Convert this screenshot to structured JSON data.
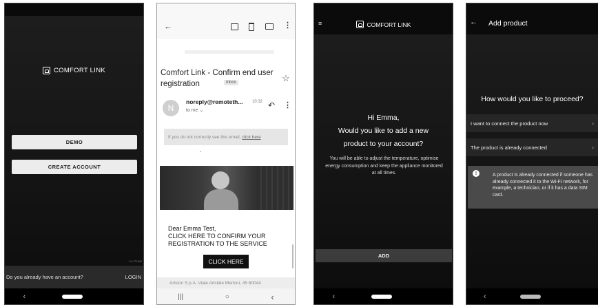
{
  "screen1": {
    "brand": "COMFORT LINK",
    "demo_label": "DEMO",
    "create_label": "CREATE ACCOUNT",
    "version": "5.0.772.800",
    "prompt": "Do you already have an account?",
    "login_label": "LOGIN"
  },
  "screen2": {
    "subject": "Comfort Link - Confirm end user registration",
    "badge": "Inbox",
    "avatar_initial": "N",
    "sender": "noreply@remoteth...",
    "time": "10:32",
    "to_me": "to me",
    "notice_prefix": "If you do not correctly see this email, ",
    "notice_link": "click here",
    "greeting": "Dear Emma Test,",
    "body_text": "CLICK HERE TO CONFIRM YOUR REGISTRATION TO THE SERVICE",
    "cta": "CLICK HERE",
    "footer": "Ariston S.p.A. Viale Aristide Merloni, 45 60044"
  },
  "screen3": {
    "brand": "COMFORT LINK",
    "greeting_line1": "Hi Emma,",
    "greeting_line2": "Would you like to add a new",
    "greeting_line3": "product to your account?",
    "description": "You will be able to adjust the temperature, optimise energy consumption and keep the appliance monitored at all times.",
    "add_label": "ADD"
  },
  "screen4": {
    "title": "Add product",
    "question": "How would you like to proceed?",
    "option1": "I want to connect the product now",
    "option2": "The product is already connected",
    "info_text": "A product is already connected if someone has already connected it to the Wi-Fi network, for example, a technician, or if it has a data SIM card."
  }
}
